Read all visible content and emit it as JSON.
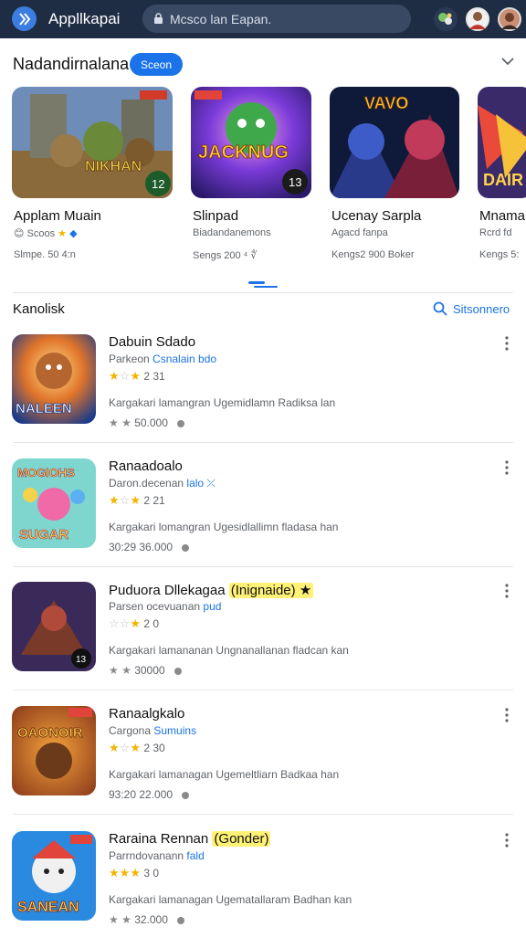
{
  "topbar": {
    "app_title": "Appllkapai",
    "search_placeholder": "Mcsco lan Eapan.",
    "icons": [
      "app-logo-icon",
      "lock-icon",
      "game-icon",
      "avatar",
      "avatar"
    ]
  },
  "featured": {
    "title": "Nadandirnalana",
    "pill_label": "Sceon",
    "cards": [
      {
        "name": "Applam Muain",
        "sub": "Scoos",
        "meta": "Slmpe. 50 4:n",
        "badge": "12"
      },
      {
        "name": "Slinpad",
        "sub": "Biadandanemons",
        "meta": "Sengs 200 ⁴ ∜",
        "badge": "13"
      },
      {
        "name": "Ucenay Sarpla",
        "sub": "Agacd fanpa",
        "meta": "Kengs2 900 Boker",
        "badge": ""
      },
      {
        "name": "Mnama",
        "sub": "Rcrd fd",
        "meta": "Kengs 5:",
        "badge": ""
      }
    ]
  },
  "list": {
    "title": "Kanolisk",
    "search_link": "Sitsonnero",
    "rows": [
      {
        "name": "Dabuin Sdado",
        "name_badge": "",
        "dev_plain": "Parkeon ",
        "dev_link": "Csnalain bdo",
        "rating": "2 31",
        "stars": 2,
        "desc": "Kargakari lamangran Ugemidlamn Radiksa lan",
        "meta": "50.000"
      },
      {
        "name": "Ranaadoalo",
        "name_badge": "",
        "dev_plain": "Daron.decenan ",
        "dev_link": "lalo ⤫",
        "rating": "2 21",
        "stars": 1,
        "desc": "Kargakari lomangran Ugesidlallimn fladasa han",
        "meta": "30:29  36.000"
      },
      {
        "name": "Puduora Dllekagaa ",
        "name_badge": "(Inignaide) ★",
        "dev_plain": "Parsen ocevuanan ",
        "dev_link": "pud",
        "rating": "2 0",
        "stars": 1,
        "desc": "Kargakari lamananan Ungnanallanan fladcan kan",
        "meta": "30000"
      },
      {
        "name": "Ranaalgkalo",
        "name_badge": "",
        "dev_plain": "Cargona ",
        "dev_link": "Sumuins",
        "rating": "2 30",
        "stars": 2,
        "desc": "Kargakari lamanagan Ugemeltliarn Badkaa han",
        "meta": "93:20  22.000"
      },
      {
        "name": "Raraina Rennan ",
        "name_badge": "(Gonder)",
        "dev_plain": "Parrndovanann ",
        "dev_link": "fald",
        "rating": "3 0",
        "stars": 3,
        "desc": "Kargakari lamanagan Ugematallaram Badhan kan",
        "meta": "32.000"
      }
    ]
  },
  "colors": {
    "topbar": "#1f2d44",
    "accent": "#1a73e8",
    "star": "#f4b400"
  }
}
